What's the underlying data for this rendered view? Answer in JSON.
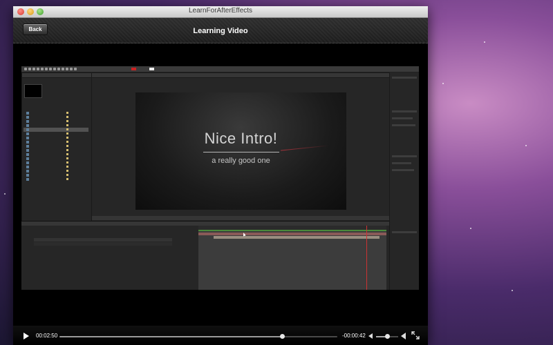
{
  "window": {
    "title": "LearnForAfterEffects"
  },
  "header": {
    "back_label": "Back",
    "title": "Learning Video"
  },
  "video": {
    "intro_title": "Nice Intro!",
    "intro_subtitle": "a really good one"
  },
  "player": {
    "elapsed": "00:02:50",
    "remaining": "-00:00:42",
    "progress_fraction": 0.8,
    "volume_fraction": 0.5
  },
  "colors": {
    "accent": "#ffffff",
    "header_bg": "#2e2e2e",
    "player_bg": "#000000"
  },
  "icons": {
    "play": "play-icon",
    "volume_low": "volume-low-icon",
    "volume_high": "volume-high-icon",
    "fullscreen": "fullscreen-icon"
  }
}
